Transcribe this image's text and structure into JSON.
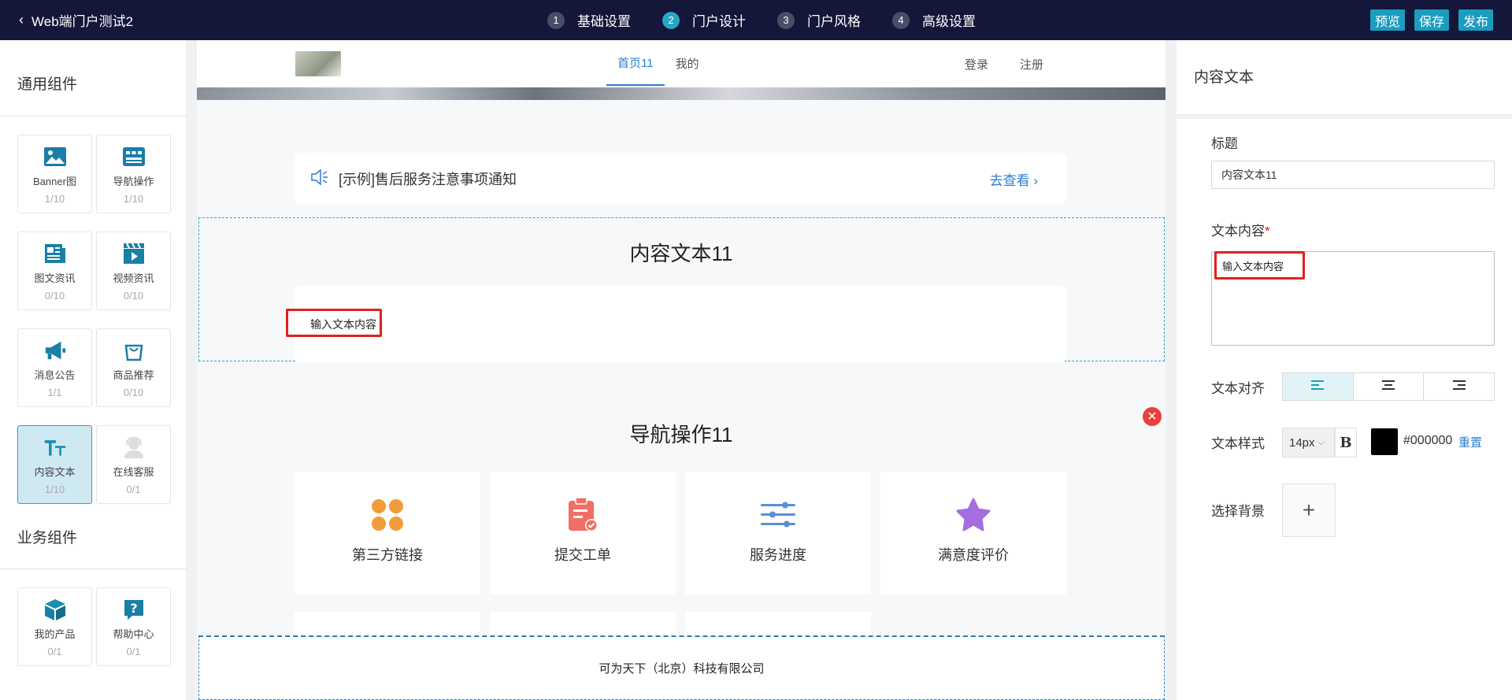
{
  "topbar": {
    "back_label": "Web端门户测试2",
    "steps": [
      {
        "num": "1",
        "label": "基础设置"
      },
      {
        "num": "2",
        "label": "门户设计"
      },
      {
        "num": "3",
        "label": "门户风格"
      },
      {
        "num": "4",
        "label": "高级设置"
      }
    ],
    "active_step": 2,
    "buttons": {
      "preview": "预览",
      "save": "保存",
      "publish": "发布"
    }
  },
  "left": {
    "general_title": "通用组件",
    "general_items": [
      {
        "name": "Banner图",
        "count": "1/10",
        "icon": "image-icon"
      },
      {
        "name": "导航操作",
        "count": "1/10",
        "icon": "nav-grid-icon"
      },
      {
        "name": "图文资讯",
        "count": "0/10",
        "icon": "article-icon"
      },
      {
        "name": "视频资讯",
        "count": "0/10",
        "icon": "video-icon"
      },
      {
        "name": "消息公告",
        "count": "1/1",
        "icon": "megaphone-icon"
      },
      {
        "name": "商品推荐",
        "count": "0/10",
        "icon": "shopping-bag-icon"
      },
      {
        "name": "内容文本",
        "count": "1/10",
        "icon": "text-icon"
      },
      {
        "name": "在线客服",
        "count": "0/1",
        "icon": "customer-service-icon"
      }
    ],
    "business_title": "业务组件",
    "business_items": [
      {
        "name": "我的产品",
        "count": "0/1",
        "icon": "cube-icon"
      },
      {
        "name": "帮助中心",
        "count": "0/1",
        "icon": "help-icon"
      }
    ]
  },
  "preview": {
    "tabs": [
      "首页11",
      "我的"
    ],
    "active_tab": 0,
    "auth": {
      "login": "登录",
      "register": "注册"
    },
    "notice": {
      "text": "[示例]售后服务注意事项通知",
      "more": "去查看"
    },
    "content_text": {
      "title": "内容文本11",
      "body": "输入文本内容"
    },
    "nav": {
      "title": "导航操作11",
      "items": [
        {
          "label": "第三方链接",
          "icon": "four-petal-icon",
          "color": "#f39a3c"
        },
        {
          "label": "提交工单",
          "icon": "clipboard-check-icon",
          "color": "#ef6f63"
        },
        {
          "label": "服务进度",
          "icon": "sliders-icon",
          "color": "#5b8fd8"
        },
        {
          "label": "满意度评价",
          "icon": "star-icon",
          "color": "#a56ee0"
        },
        {
          "label": "",
          "icon": "edit-doc-icon",
          "color": "#8fd05a"
        },
        {
          "label": "",
          "icon": "headset-agent-icon",
          "color": "#f17865"
        },
        {
          "label": "",
          "icon": "bag-icon",
          "color": "#4fc7cf"
        }
      ]
    },
    "footer": "可为天下（北京）科技有限公司"
  },
  "panel": {
    "title": "内容文本",
    "title_label": "标题",
    "title_value": "内容文本11",
    "content_label": "文本内容",
    "required_mark": "*",
    "content_value": "输入文本内容",
    "align_label": "文本对齐",
    "align_active": "left",
    "style_label": "文本样式",
    "font_size": "14px",
    "bold_label": "B",
    "color_value": "#000000",
    "reset_label": "重置",
    "bg_label": "选择背景",
    "bg_add": "+"
  },
  "colors": {
    "accent": "#1a9dbf",
    "topbar": "#14163a",
    "link": "#2d7fd3",
    "highlight": "#e02020"
  }
}
